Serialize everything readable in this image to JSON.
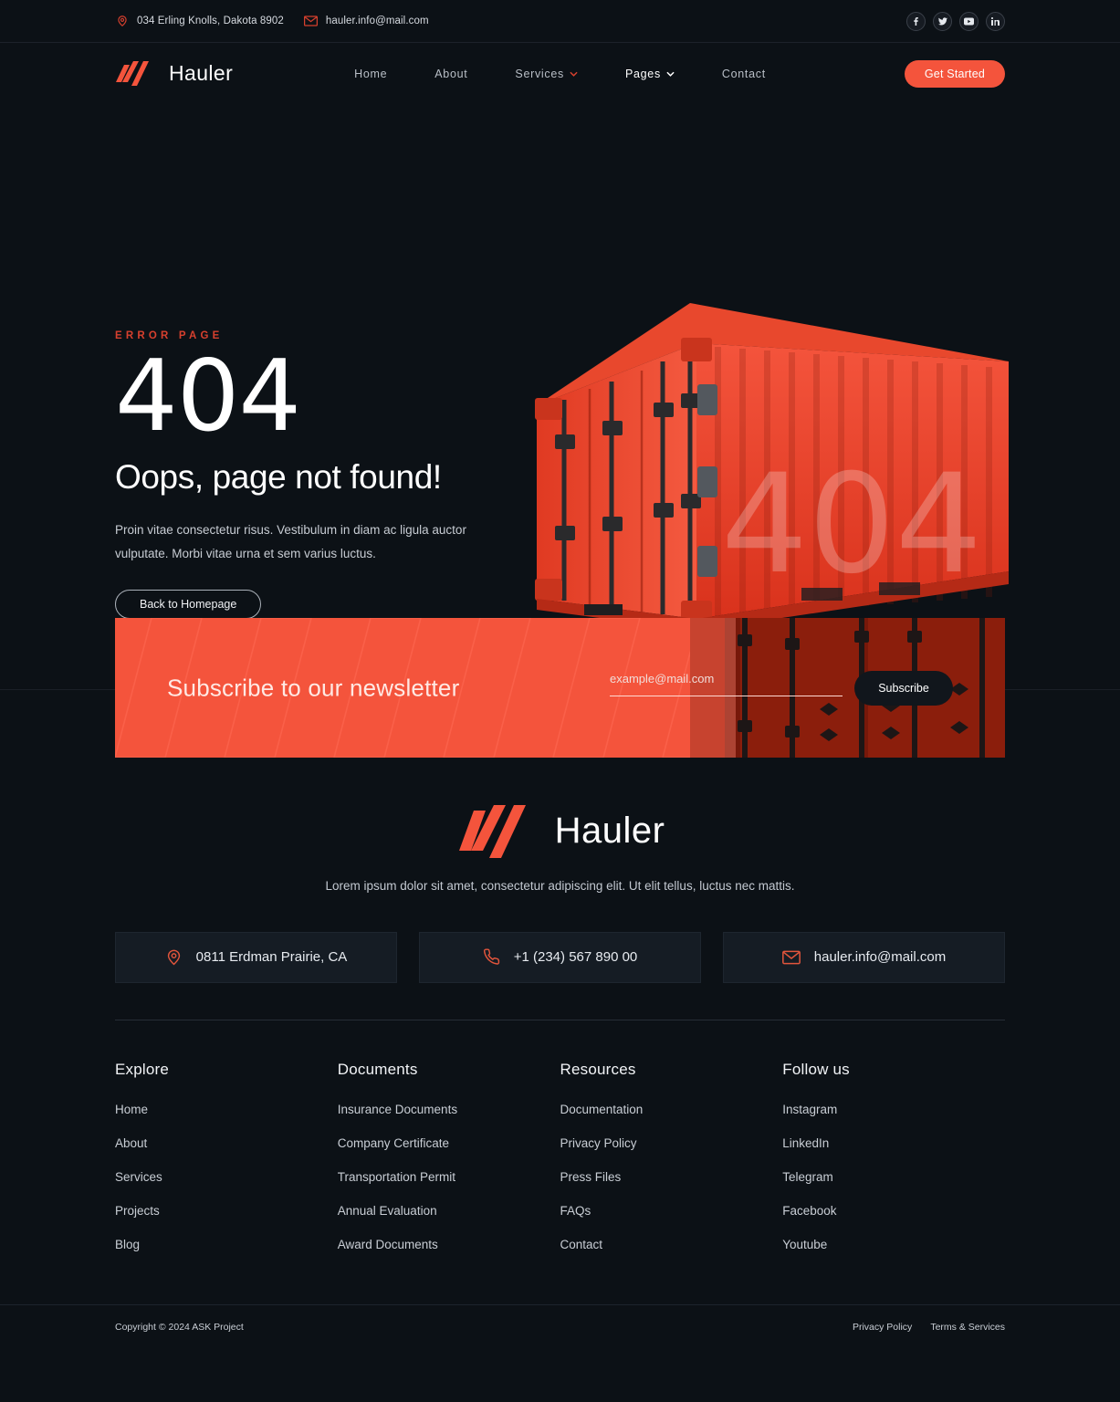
{
  "topbar": {
    "address": "034 Erling Knolls, Dakota 8902",
    "email": "hauler.info@mail.com",
    "address_icon": "location-pin-icon",
    "email_icon": "envelope-icon",
    "socials": [
      {
        "name": "facebook",
        "label": "f"
      },
      {
        "name": "twitter",
        "label": "t"
      },
      {
        "name": "youtube",
        "label": "y"
      },
      {
        "name": "linkedin",
        "label": "in"
      }
    ]
  },
  "nav": {
    "logo_text": "Hauler",
    "items": [
      {
        "label": "Home",
        "has_chevron": false,
        "active": false
      },
      {
        "label": "About",
        "has_chevron": false,
        "active": false
      },
      {
        "label": "Services",
        "has_chevron": true,
        "active": false
      },
      {
        "label": "Pages",
        "has_chevron": true,
        "active": true
      },
      {
        "label": "Contact",
        "has_chevron": false,
        "active": false
      }
    ],
    "cta_label": "Get Started"
  },
  "hero": {
    "eyebrow": "ERROR PAGE",
    "code": "404",
    "title": "Oops, page not found!",
    "paragraph": "Proin vitae consectetur risus. Vestibulum in diam ac ligula auctor vulputate. Morbi vitae urna et sem varius luctus.",
    "button_label": "Back to Homepage",
    "image_alt": "red-shipping-container-404"
  },
  "newsletter": {
    "title": "Subscribe to our newsletter",
    "input_placeholder": "example@mail.com",
    "input_value": "",
    "button_label": "Subscribe"
  },
  "footer": {
    "logo_text": "Hauler",
    "tagline": "Lorem ipsum dolor sit amet, consectetur adipiscing elit. Ut elit tellus, luctus nec mattis.",
    "cards": [
      {
        "icon": "location-pin-icon",
        "text": "0811 Erdman Prairie, CA"
      },
      {
        "icon": "phone-icon",
        "text": "+1 (234) 567 890 00"
      },
      {
        "icon": "envelope-icon",
        "text": "hauler.info@mail.com"
      }
    ],
    "columns": [
      {
        "title": "Explore",
        "links": [
          "Home",
          "About",
          "Services",
          "Projects",
          "Blog"
        ]
      },
      {
        "title": "Documents",
        "links": [
          "Insurance Documents",
          "Company Certificate",
          "Transportation Permit",
          "Annual Evaluation",
          "Award Documents"
        ]
      },
      {
        "title": "Resources",
        "links": [
          "Documentation",
          "Privacy Policy",
          "Press Files",
          "FAQs",
          "Contact"
        ]
      },
      {
        "title": "Follow us",
        "links": [
          "Instagram",
          "LinkedIn",
          "Telegram",
          "Facebook",
          "Youtube"
        ]
      }
    ],
    "copyright": "Copyright © 2024 ASK Project",
    "legal_links": [
      "Privacy Policy",
      "Terms & Services"
    ]
  },
  "colors": {
    "accent": "#f4543c",
    "accent_dark": "#d6402e",
    "background": "#0c1116",
    "card_bg": "#151c24",
    "text": "#e9edf2"
  }
}
